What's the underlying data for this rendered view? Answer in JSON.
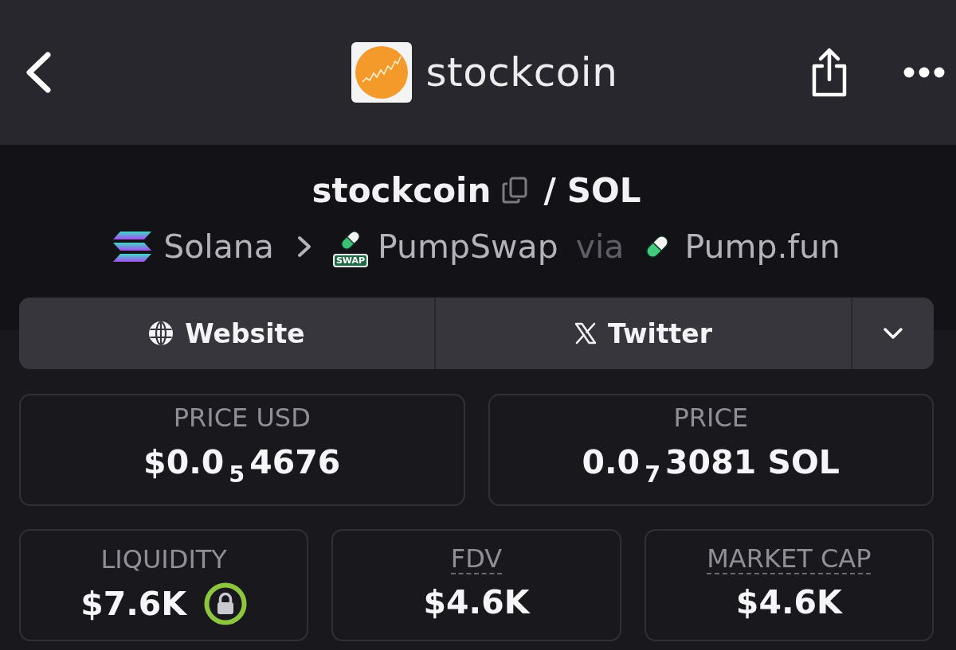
{
  "header": {
    "title": "stockcoin"
  },
  "pair": {
    "base": "stockcoin",
    "separator": "/",
    "quote": "SOL"
  },
  "route": {
    "chain": "Solana",
    "dex": "PumpSwap",
    "dex_badge": "SWAP",
    "via": "via",
    "launchpad": "Pump.fun"
  },
  "links": [
    {
      "kind": "website",
      "label": "Website"
    },
    {
      "kind": "twitter",
      "label": "Twitter"
    }
  ],
  "prices": [
    {
      "label": "PRICE USD",
      "value": "$0.0$_{5}$4676"
    },
    {
      "label": "PRICE",
      "value": "0.0$_{7}$3081 SOL"
    }
  ],
  "stats": [
    {
      "label": "LIQUIDITY",
      "value": "$7.6K",
      "locked": true,
      "has_info": false
    },
    {
      "label": "FDV",
      "value": "$4.6K",
      "locked": false,
      "has_info": true
    },
    {
      "label": "MARKET CAP",
      "value": "$4.6K",
      "locked": false,
      "has_info": true
    }
  ]
}
